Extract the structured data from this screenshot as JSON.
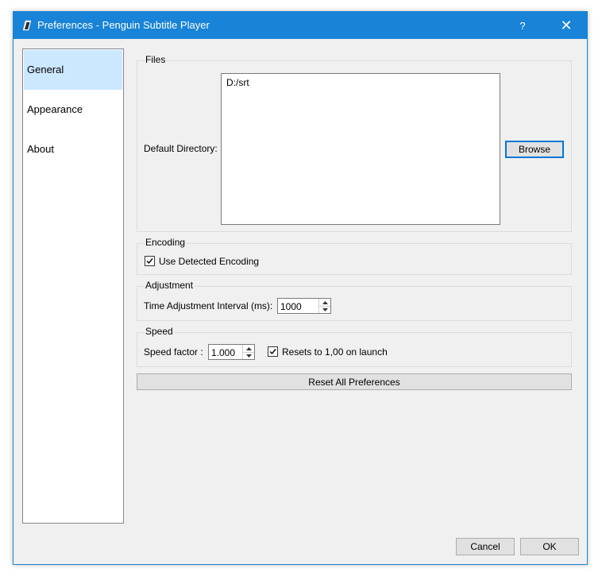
{
  "window": {
    "title": "Preferences - Penguin Subtitle Player",
    "help_glyph": "?",
    "close_glyph": "✕"
  },
  "sidebar": {
    "items": [
      {
        "label": "General",
        "selected": true
      },
      {
        "label": "Appearance",
        "selected": false
      },
      {
        "label": "About",
        "selected": false
      }
    ]
  },
  "files": {
    "group_title": "Files",
    "default_directory_label": "Default Directory:",
    "default_directory_value": "D:/srt",
    "browse_label": "Browse"
  },
  "encoding": {
    "group_title": "Encoding",
    "use_detected_label": "Use Detected Encoding",
    "use_detected_checked": true
  },
  "adjustment": {
    "group_title": "Adjustment",
    "interval_label": "Time Adjustment Interval (ms):",
    "interval_value": "1000"
  },
  "speed": {
    "group_title": "Speed",
    "factor_label": "Speed factor :",
    "factor_value": "1.000",
    "resets_label": "Resets to 1,00 on launch",
    "resets_checked": true
  },
  "actions": {
    "reset_label": "Reset All Preferences",
    "cancel_label": "Cancel",
    "ok_label": "OK"
  },
  "colors": {
    "accent": "#1883d7",
    "selection": "#cce8ff",
    "background": "#f0f0f0"
  }
}
